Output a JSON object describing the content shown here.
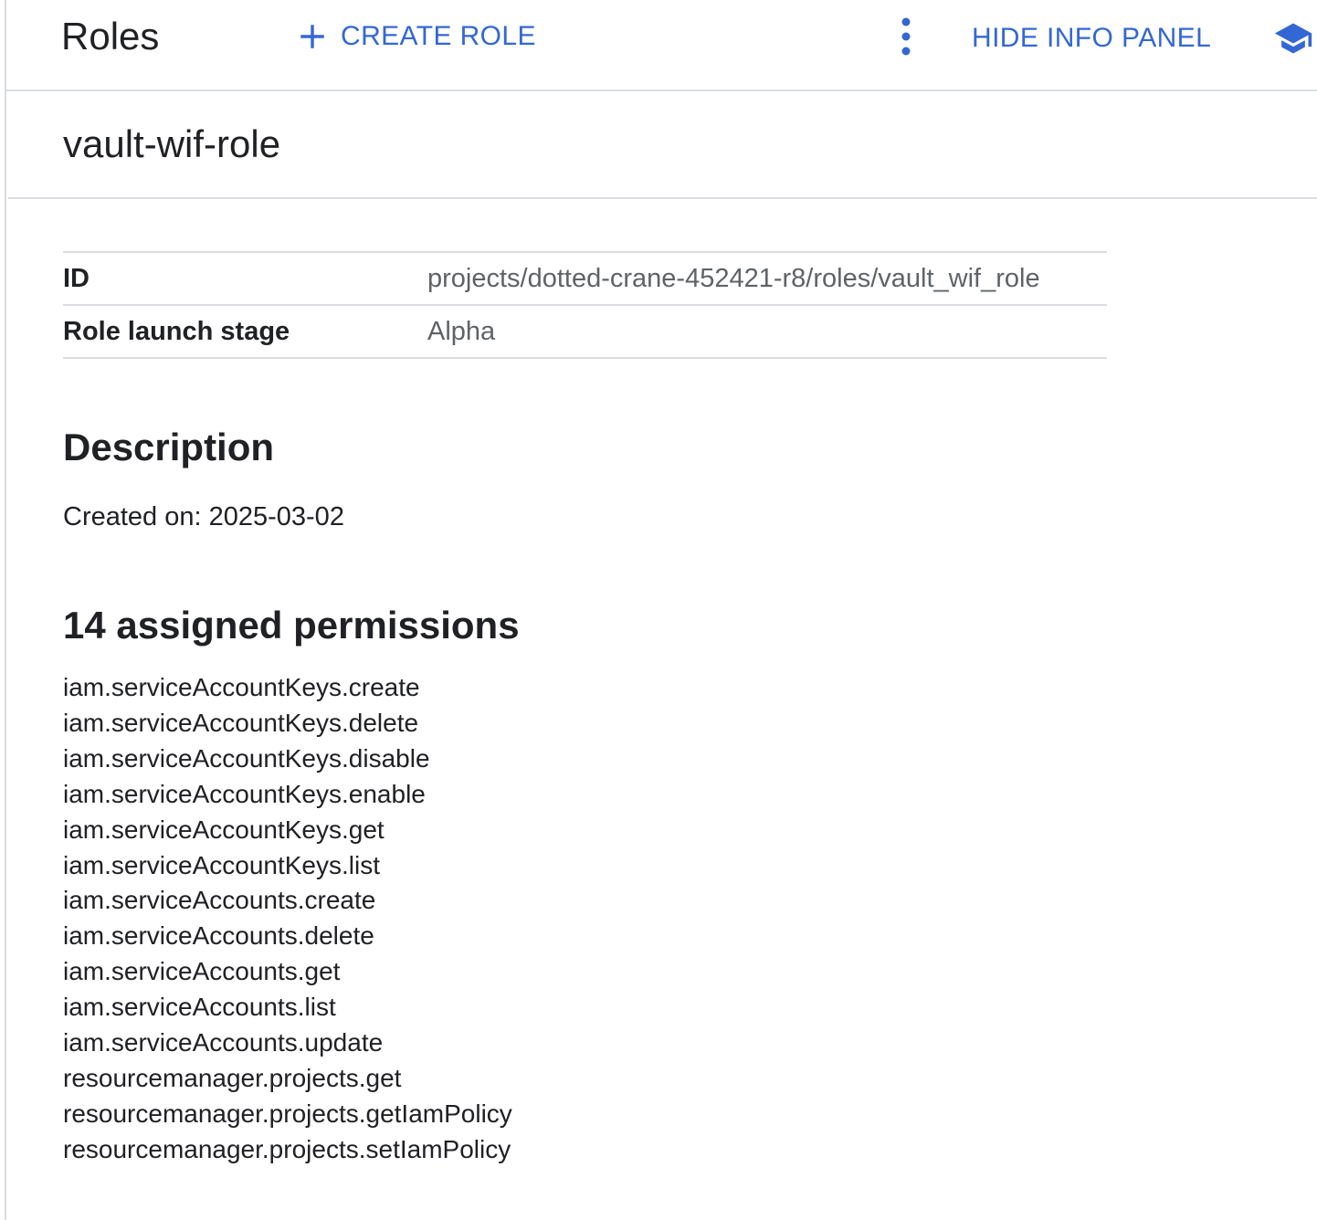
{
  "header": {
    "title": "Roles",
    "create_label": "CREATE ROLE",
    "hide_panel_label": "HIDE INFO PANEL"
  },
  "icons": {
    "create": "plus-icon",
    "more": "more-vert-icon",
    "learn": "school-icon",
    "accent_color": "#3367d6"
  },
  "role": {
    "name": "vault-wif-role"
  },
  "details": {
    "rows": [
      {
        "key": "ID",
        "value": "projects/dotted-crane-452421-r8/roles/vault_wif_role"
      },
      {
        "key": "Role launch stage",
        "value": "Alpha"
      }
    ]
  },
  "description": {
    "heading": "Description",
    "text": "Created on: 2025-03-02"
  },
  "permissions": {
    "heading": "14 assigned permissions",
    "items": [
      "iam.serviceAccountKeys.create",
      "iam.serviceAccountKeys.delete",
      "iam.serviceAccountKeys.disable",
      "iam.serviceAccountKeys.enable",
      "iam.serviceAccountKeys.get",
      "iam.serviceAccountKeys.list",
      "iam.serviceAccounts.create",
      "iam.serviceAccounts.delete",
      "iam.serviceAccounts.get",
      "iam.serviceAccounts.list",
      "iam.serviceAccounts.update",
      "resourcemanager.projects.get",
      "resourcemanager.projects.getIamPolicy",
      "resourcemanager.projects.setIamPolicy"
    ]
  }
}
